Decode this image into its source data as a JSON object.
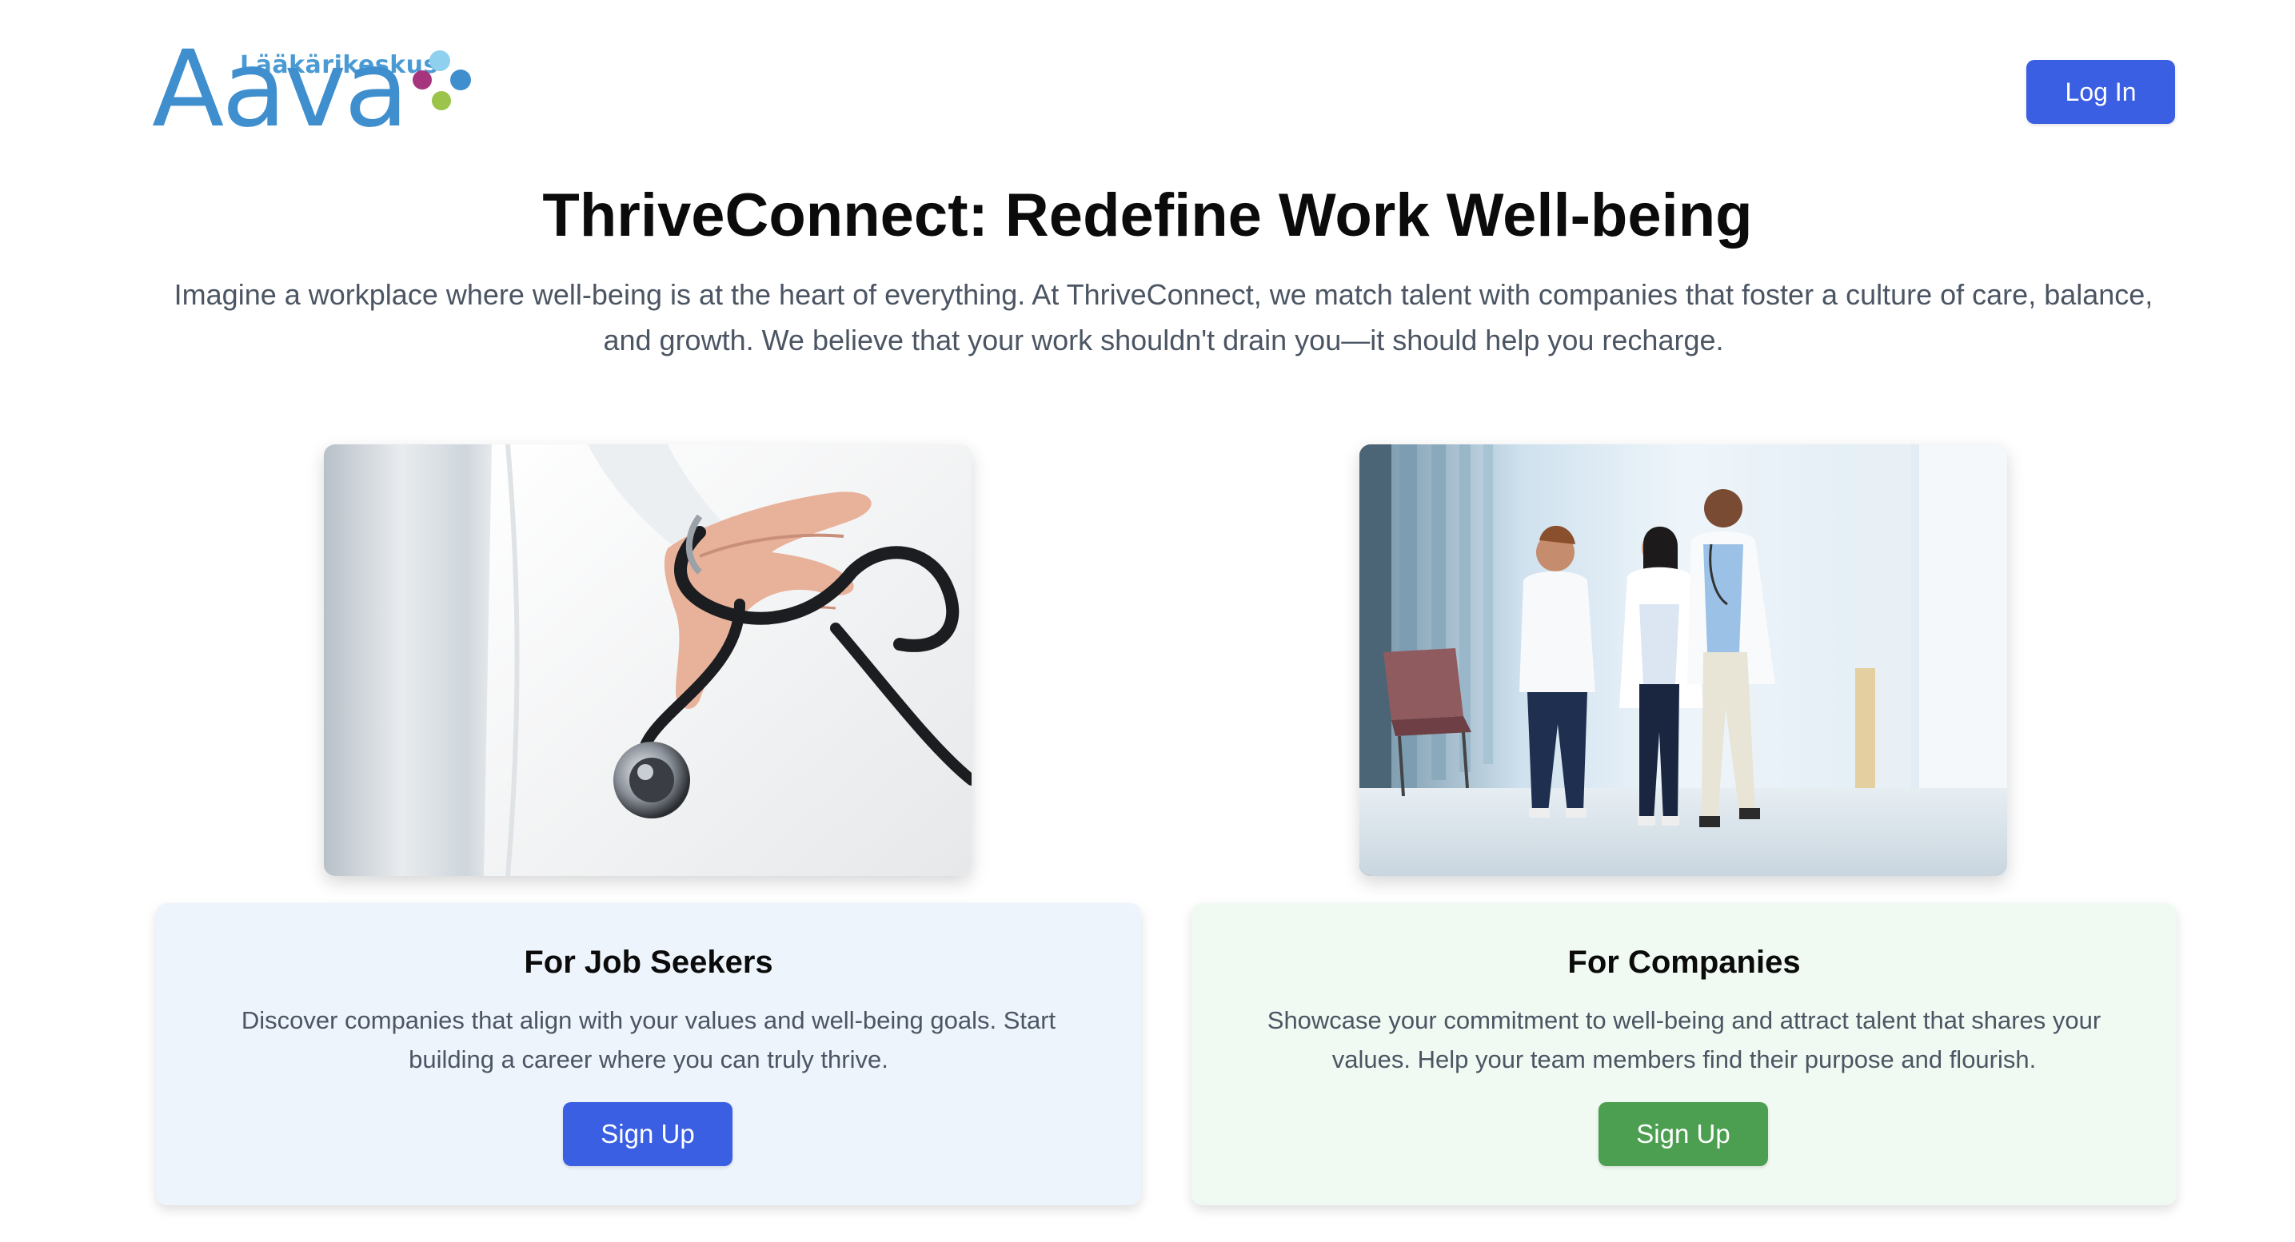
{
  "header": {
    "logo": {
      "subtitle": "Lääkärikeskus",
      "name": "Aava",
      "dot_colors": [
        "#8fd0ee",
        "#a6357e",
        "#3f8fcf",
        "#9cc44a"
      ]
    },
    "login_label": "Log In"
  },
  "hero": {
    "title": "ThriveConnect: Redefine Work Well-being",
    "text": "Imagine a workplace where well-being is at the heart of everything. At ThriveConnect, we match talent with companies that foster a culture of care, balance, and growth. We believe that your work shouldn't drain you—it should help you recharge."
  },
  "images": {
    "left": "doctor-with-stethoscope-photo",
    "right": "doctors-walking-in-hospital-corridor-photo"
  },
  "cards": {
    "job_seekers": {
      "title": "For Job Seekers",
      "text": "Discover companies that align with your values and well-being goals. Start building a career where you can truly thrive.",
      "button_label": "Sign Up",
      "background": "#eef4fc",
      "button_color": "#3a5fe2"
    },
    "companies": {
      "title": "For Companies",
      "text": "Showcase your commitment to well-being and attract talent that shares your values. Help your team members find their purpose and flourish.",
      "button_label": "Sign Up",
      "background": "#f0faf2",
      "button_color": "#4c9f50"
    }
  },
  "colors": {
    "primary": "#3a5fe2",
    "success": "#4c9f50",
    "text_muted": "#4b5563",
    "logo_blue": "#3f8fcf"
  }
}
